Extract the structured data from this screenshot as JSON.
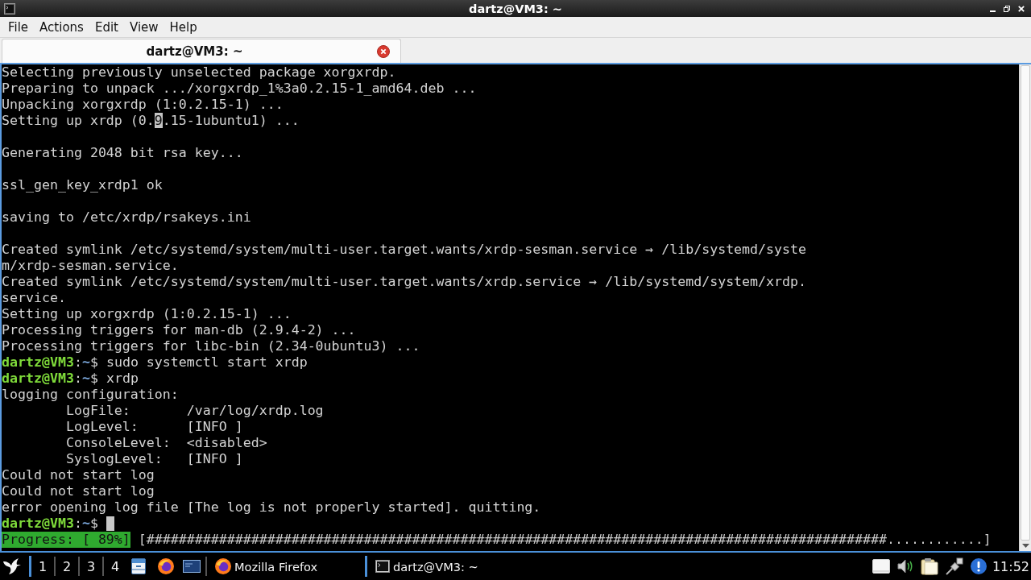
{
  "window": {
    "title": "dartz@VM3: ~"
  },
  "menu": [
    "File",
    "Actions",
    "Edit",
    "View",
    "Help"
  ],
  "tabs": [
    {
      "label": "dartz@VM3: ~",
      "selected": true
    }
  ],
  "terminal": {
    "lines": [
      {
        "kind": "output",
        "text": "Selecting previously unselected package xorgxrdp."
      },
      {
        "kind": "output",
        "text": "Preparing to unpack .../xorgxrdp_1%3a0.2.15-1_amd64.deb ..."
      },
      {
        "kind": "output",
        "text": "Unpacking xorgxrdp (1:0.2.15-1) ..."
      },
      {
        "kind": "selection",
        "segments": [
          {
            "text": "Setting up xrdp (0.",
            "selected": false
          },
          {
            "text": "9",
            "selected": true
          },
          {
            "text": ".15-1ubuntu1) ...",
            "selected": false
          }
        ]
      },
      {
        "kind": "blank"
      },
      {
        "kind": "output",
        "text": "Generating 2048 bit rsa key..."
      },
      {
        "kind": "blank"
      },
      {
        "kind": "output",
        "text": "ssl_gen_key_xrdp1 ok"
      },
      {
        "kind": "blank"
      },
      {
        "kind": "output",
        "text": "saving to /etc/xrdp/rsakeys.ini"
      },
      {
        "kind": "blank"
      },
      {
        "kind": "output",
        "text": "Created symlink /etc/systemd/system/multi-user.target.wants/xrdp-sesman.service → /lib/systemd/syste"
      },
      {
        "kind": "output",
        "text": "m/xrdp-sesman.service."
      },
      {
        "kind": "output",
        "text": "Created symlink /etc/systemd/system/multi-user.target.wants/xrdp.service → /lib/systemd/system/xrdp."
      },
      {
        "kind": "output",
        "text": "service."
      },
      {
        "kind": "output",
        "text": "Setting up xorgxrdp (1:0.2.15-1) ..."
      },
      {
        "kind": "output",
        "text": "Processing triggers for man-db (2.9.4-2) ..."
      },
      {
        "kind": "output",
        "text": "Processing triggers for libc-bin (2.34-0ubuntu3) ..."
      },
      {
        "kind": "prompt",
        "user_host": "dartz@VM3",
        "separator": ":",
        "path": "~",
        "symbol": "$",
        "command": "sudo systemctl start xrdp",
        "cursor": false
      },
      {
        "kind": "prompt",
        "user_host": "dartz@VM3",
        "separator": ":",
        "path": "~",
        "symbol": "$",
        "command": "xrdp",
        "cursor": false
      },
      {
        "kind": "output",
        "text": "logging configuration:"
      },
      {
        "kind": "indented",
        "text": "LogFile:       /var/log/xrdp.log"
      },
      {
        "kind": "indented",
        "text": "LogLevel:      [INFO ]"
      },
      {
        "kind": "indented",
        "text": "ConsoleLevel:  <disabled>"
      },
      {
        "kind": "indented",
        "text": "SyslogLevel:   [INFO ]"
      },
      {
        "kind": "output",
        "text": "Could not start log"
      },
      {
        "kind": "output",
        "text": "Could not start log"
      },
      {
        "kind": "output",
        "text": "error opening log file [The log is not properly started]. quitting."
      },
      {
        "kind": "prompt",
        "user_host": "dartz@VM3",
        "separator": ":",
        "path": "~",
        "symbol": "$",
        "cursor": true
      },
      {
        "kind": "progress",
        "label": "Progress: [ 89%]",
        "bar": "[############################################################################################............]"
      }
    ]
  },
  "taskbar": {
    "workspaces": [
      "1",
      "2",
      "3",
      "4"
    ],
    "tasks": [
      {
        "kind": "browser",
        "label": "Mozilla Firefox"
      },
      {
        "kind": "terminal",
        "label": "dartz@VM3: ~"
      }
    ],
    "clock": "11:52"
  }
}
